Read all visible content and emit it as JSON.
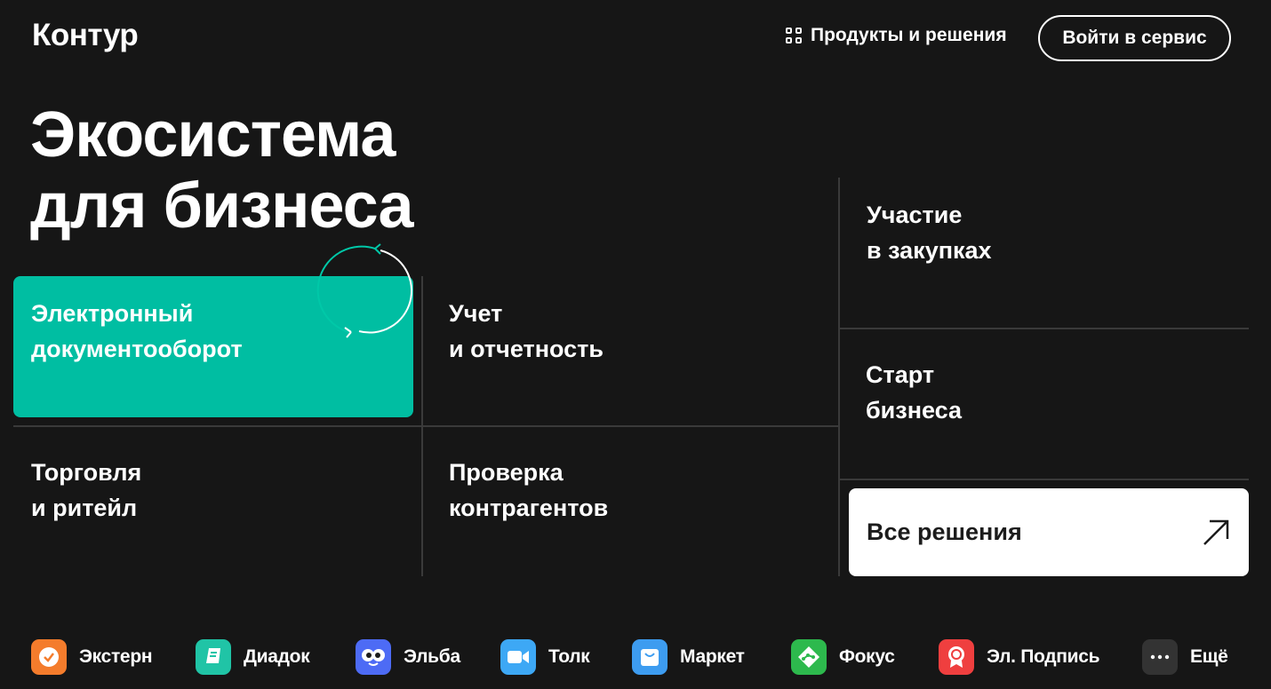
{
  "header": {
    "logo": "Контур",
    "products_label": "Продукты и решения",
    "login_label": "Войти в сервис"
  },
  "hero": {
    "title_line1": "Экосистема",
    "title_line2": "для бизнеса"
  },
  "tiles": [
    {
      "line1": "Электронный",
      "line2": "документооборот"
    },
    {
      "line1": "Учет",
      "line2": "и отчетность"
    },
    {
      "line1": "Торговля",
      "line2": "и ритейл"
    },
    {
      "line1": "Проверка",
      "line2": "контрагентов"
    },
    {
      "line1": "Участие",
      "line2": "в закупках"
    },
    {
      "line1": "Старт",
      "line2": "бизнеса"
    }
  ],
  "all_solutions": {
    "label": "Все решения",
    "icon": "arrow-up-right-icon"
  },
  "products": [
    {
      "label": "Экстерн",
      "icon": "check-icon",
      "color": "#f47c2c"
    },
    {
      "label": "Диадок",
      "icon": "document-icon",
      "color": "#20c4a6"
    },
    {
      "label": "Эльба",
      "icon": "eyes-icon",
      "color": "#4d6bf5"
    },
    {
      "label": "Толк",
      "icon": "camera-icon",
      "color": "#3da8f5"
    },
    {
      "label": "Маркет",
      "icon": "bag-icon",
      "color": "#3d9cf0"
    },
    {
      "label": "Фокус",
      "icon": "graph-icon",
      "color": "#2db94d"
    },
    {
      "label": "Эл. Подпись",
      "icon": "badge-icon",
      "color": "#ef3f3f"
    },
    {
      "label": "Ещё",
      "icon": "more-icon",
      "color": "#333333"
    }
  ],
  "colors": {
    "background": "#161616",
    "accent": "#00bea2",
    "divider": "#3a3a3a"
  }
}
